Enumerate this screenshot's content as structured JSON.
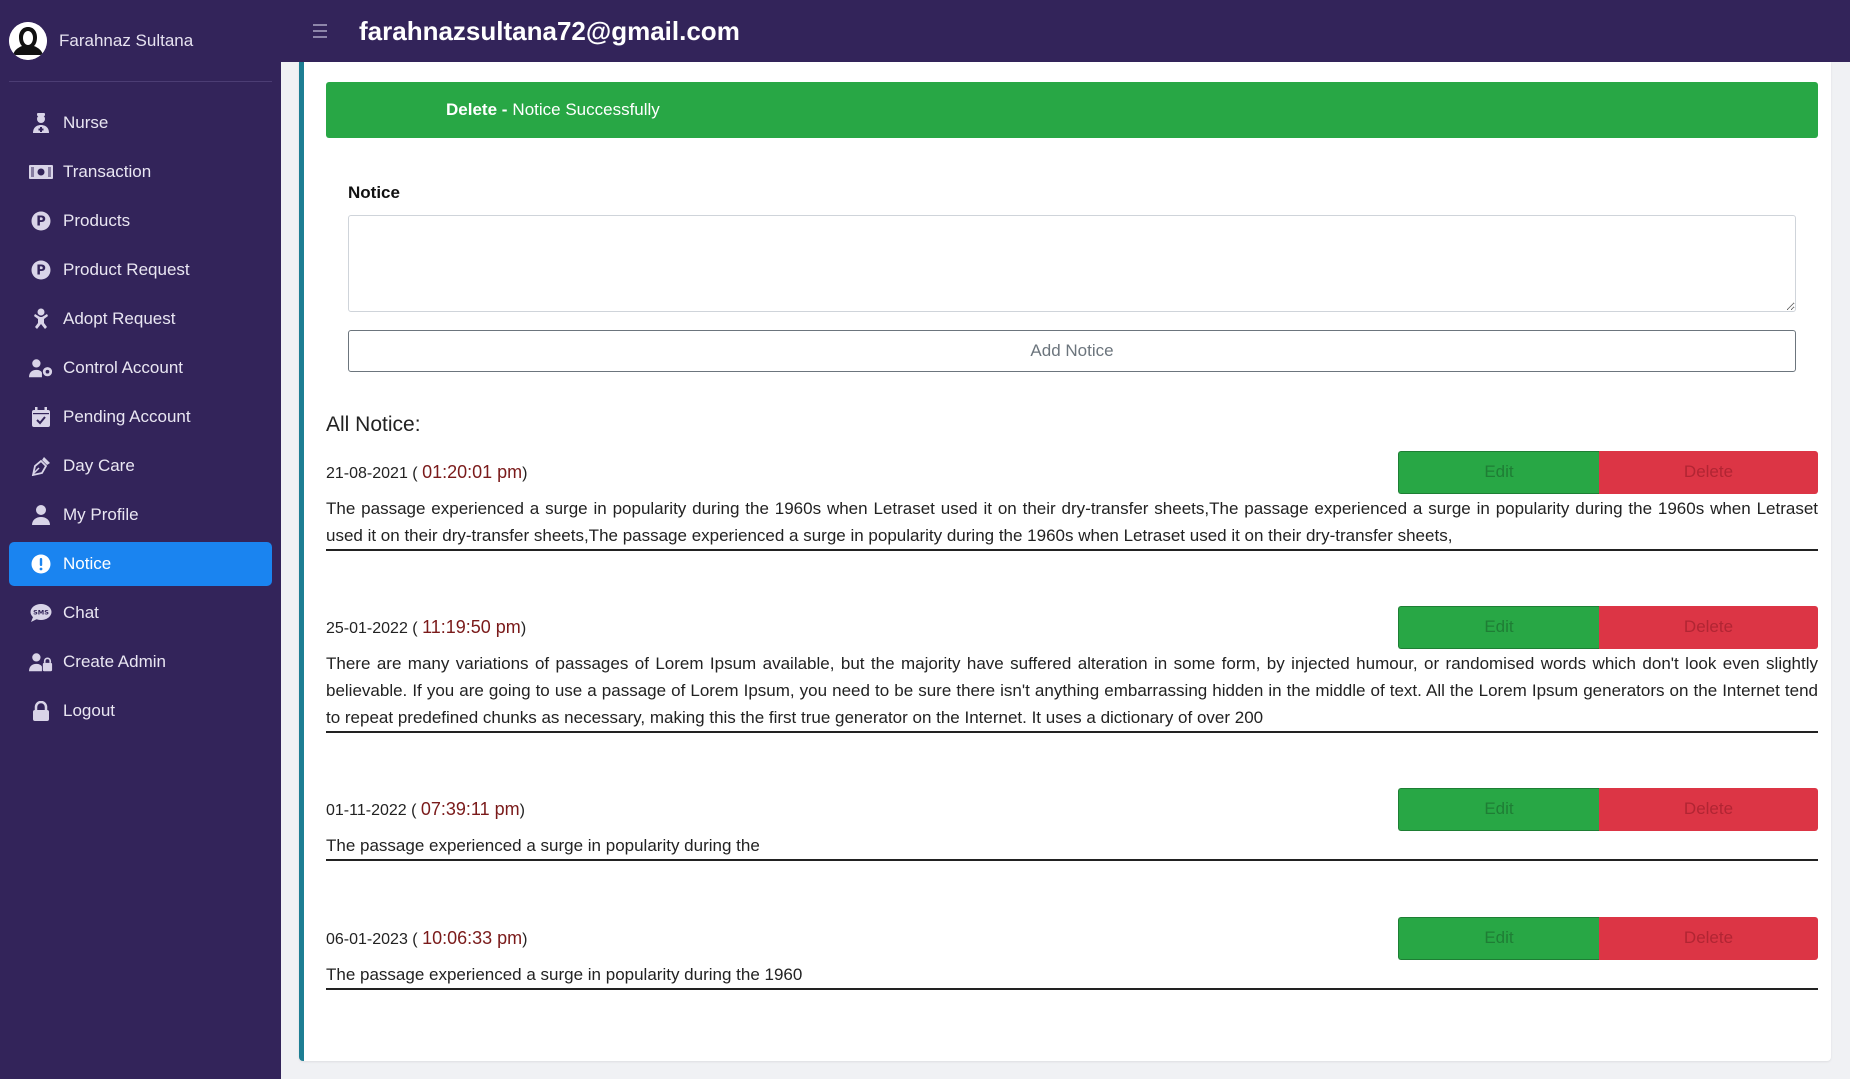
{
  "user": {
    "name": "Farahnaz Sultana",
    "email": "farahnazsultana72@gmail.com"
  },
  "sidebar": {
    "items": [
      {
        "label": "Nurse",
        "icon": "nurse-icon"
      },
      {
        "label": "Transaction",
        "icon": "money-icon"
      },
      {
        "label": "Products",
        "icon": "product-p-icon"
      },
      {
        "label": "Product Request",
        "icon": "product-p-icon"
      },
      {
        "label": "Adopt Request",
        "icon": "baby-icon"
      },
      {
        "label": "Control Account",
        "icon": "user-gear-icon"
      },
      {
        "label": "Pending Account",
        "icon": "calendar-check-icon"
      },
      {
        "label": "Day Care",
        "icon": "pen-nib-icon"
      },
      {
        "label": "My Profile",
        "icon": "user-icon"
      },
      {
        "label": "Notice",
        "icon": "exclamation-circle-icon",
        "active": true
      },
      {
        "label": "Chat",
        "icon": "sms-icon"
      },
      {
        "label": "Create Admin",
        "icon": "user-lock-icon"
      },
      {
        "label": "Logout",
        "icon": "lock-icon"
      }
    ]
  },
  "alert": {
    "strong": "Delete -",
    "message": "Notice Successfully",
    "color": "#28a745"
  },
  "form": {
    "label": "Notice",
    "textarea_value": "",
    "add_button": "Add Notice"
  },
  "list": {
    "heading": "All Notice:",
    "edit_label": "Edit",
    "delete_label": "Delete",
    "notices": [
      {
        "date": "21-08-2021",
        "time": "01:20:01 pm",
        "text": "The passage experienced a surge in popularity during the 1960s when Letraset used it on their dry-transfer sheets,The passage experienced a surge in popularity during the 1960s when Letraset used it on their dry-transfer sheets,The passage experienced a surge in popularity during the 1960s when Letraset used it on their dry-transfer sheets,"
      },
      {
        "date": "25-01-2022",
        "time": "11:19:50 pm",
        "text": "There are many variations of passages of Lorem Ipsum available, but the majority have suffered alteration in some form, by injected humour, or randomised words which don't look even slightly believable. If you are going to use a passage of Lorem Ipsum, you need to be sure there isn't anything embarrassing hidden in the middle of text. All the Lorem Ipsum generators on the Internet tend to repeat predefined chunks as necessary, making this the first true generator on the Internet. It uses a dictionary of over 200"
      },
      {
        "date": "01-11-2022",
        "time": "07:39:11 pm",
        "text": "The passage experienced a surge in popularity during the"
      },
      {
        "date": "06-01-2023",
        "time": "10:06:33 pm",
        "text": "The passage experienced a surge in popularity during the 1960"
      }
    ]
  },
  "colors": {
    "sidebar_bg": "#33245a",
    "active_item": "#1a84f0",
    "edit": "#28a745",
    "delete": "#dc3545",
    "card_accent": "#1d7e93"
  }
}
